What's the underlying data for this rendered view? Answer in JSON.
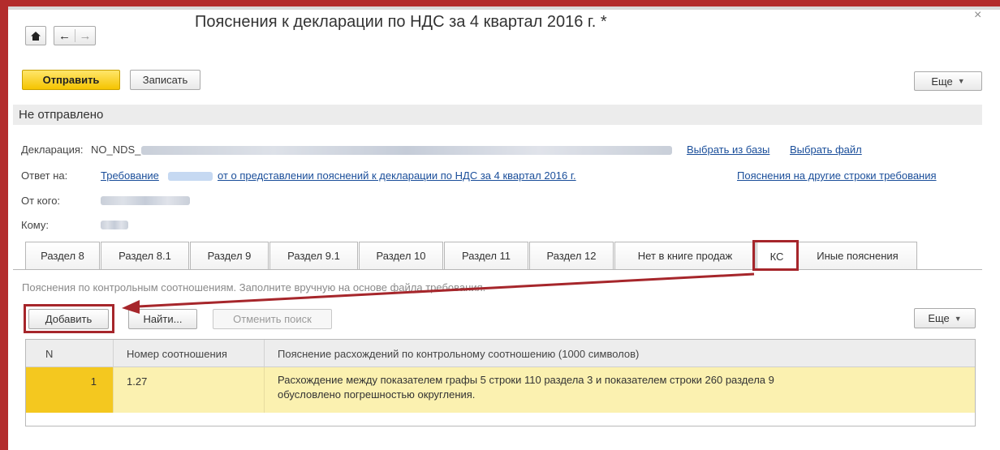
{
  "window": {
    "title": "Пояснения к декларации по НДС за 4 квартал 2016 г. *",
    "close_symbol": "×",
    "home_icon": "home-icon",
    "back_symbol": "←",
    "forward_symbol": "→"
  },
  "toolbar": {
    "send_label": "Отправить",
    "save_label": "Записать",
    "more_label": "Еще"
  },
  "status": {
    "text": "Не отправлено"
  },
  "form": {
    "declaration_label": "Декларация:",
    "declaration_value": "NO_NDS_",
    "select_from_db_link": "Выбрать из базы",
    "select_file_link": "Выбрать файл",
    "reply_label": "Ответ на:",
    "reply_link_prefix": "Требование",
    "reply_link_suffix": "от  о представлении пояснений к декларации по НДС за 4 квартал 2016 г.",
    "other_rows_link": "Пояснения на другие строки требования",
    "from_label": "От кого:",
    "to_label": "Кому:"
  },
  "tabs": [
    {
      "label": "Раздел 8"
    },
    {
      "label": "Раздел 8.1"
    },
    {
      "label": "Раздел 9"
    },
    {
      "label": "Раздел 9.1"
    },
    {
      "label": "Раздел 10"
    },
    {
      "label": "Раздел 11"
    },
    {
      "label": "Раздел 12"
    },
    {
      "label": "Нет в книге продаж"
    },
    {
      "label": "КС"
    },
    {
      "label": "Иные пояснения"
    }
  ],
  "active_tab": "КС",
  "ks": {
    "hint": "Пояснения по контрольным соотношениям. Заполните вручную на основе файла требования.",
    "add_label": "Добавить",
    "find_label": "Найти...",
    "cancel_search_label": "Отменить поиск",
    "more_label": "Еще"
  },
  "table": {
    "columns": [
      "N",
      "Номер соотношения",
      "Пояснение расхождений по контрольному соотношению (1000 символов)"
    ],
    "rows": [
      {
        "n": "1",
        "ratio": "1.27",
        "line1": "Расхождение между показателем графы 5 строки 110 раздела 3 и показателем строки 260 раздела 9",
        "line2": "обусловлено  погрешностью округления."
      }
    ]
  },
  "colors": {
    "accent_red": "#a6262b",
    "primary_button": "#f5c400",
    "selected_row": "#fbf1b0",
    "link": "#1a4e9a"
  }
}
